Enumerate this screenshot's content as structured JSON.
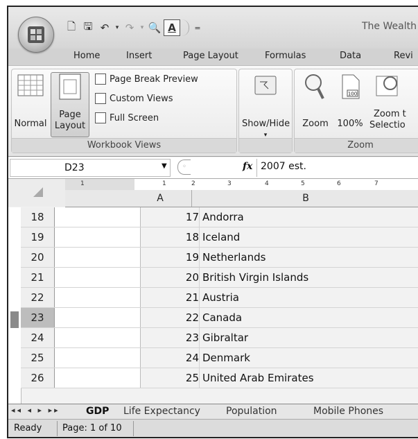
{
  "window": {
    "title": "The Wealth C"
  },
  "tabs": [
    "Home",
    "Insert",
    "Page Layout",
    "Formulas",
    "Data",
    "Revi"
  ],
  "ribbon": {
    "workbook_views": {
      "label": "Workbook Views",
      "normal": "Normal",
      "page_layout_line1": "Page",
      "page_layout_line2": "Layout",
      "page_break_preview": "Page Break Preview",
      "custom_views": "Custom Views",
      "full_screen": "Full Screen"
    },
    "show_hide": {
      "label": "Show/Hide"
    },
    "zoom": {
      "label": "Zoom",
      "zoom": "Zoom",
      "hundred": "100%",
      "hundred_icon": "100",
      "zoom_to_line1": "Zoom t",
      "zoom_to_line2": "Selectio"
    }
  },
  "formula_bar": {
    "name_box": "D23",
    "fx": "fx",
    "value": "2007 est."
  },
  "ruler": {
    "marks": [
      "1",
      "1",
      "2",
      "3",
      "4",
      "5",
      "6",
      "7"
    ]
  },
  "columns": [
    "A",
    "B"
  ],
  "rows": [
    {
      "num": "18",
      "a": "17",
      "b": "Andorra"
    },
    {
      "num": "19",
      "a": "18",
      "b": "Iceland"
    },
    {
      "num": "20",
      "a": "19",
      "b": "Netherlands"
    },
    {
      "num": "21",
      "a": "20",
      "b": "British Virgin Islands"
    },
    {
      "num": "22",
      "a": "21",
      "b": "Austria"
    },
    {
      "num": "23",
      "a": "22",
      "b": "Canada",
      "active": true
    },
    {
      "num": "24",
      "a": "23",
      "b": "Gibraltar"
    },
    {
      "num": "25",
      "a": "24",
      "b": "Denmark"
    },
    {
      "num": "26",
      "a": "25",
      "b": "United Arab Emirates"
    }
  ],
  "sheet_tabs": [
    "GDP",
    "Life Expectancy",
    "Population",
    "Mobile Phones"
  ],
  "status": {
    "ready": "Ready",
    "page": "Page: 1 of 10"
  }
}
